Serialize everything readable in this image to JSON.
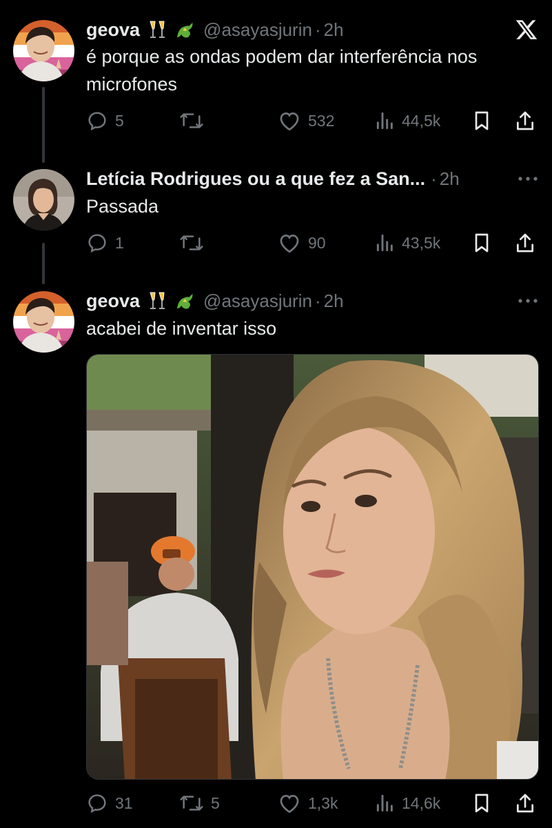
{
  "logo": "x-logo",
  "tweets": [
    {
      "display_name": "geova",
      "emojis": [
        "clinking-glasses-emoji",
        "dragon-emoji"
      ],
      "handle": "@asayasjurin",
      "separator": "·",
      "time": "2h",
      "text": "é porque as ondas podem dar interferência nos microfones",
      "stats": {
        "replies": "5",
        "reposts": "",
        "likes": "532",
        "views": "44,5k"
      }
    },
    {
      "display_name": "Letícia Rodrigues ou a que fez a San...",
      "handle": "",
      "separator": "·",
      "time": "2h",
      "text": "Passada",
      "stats": {
        "replies": "1",
        "reposts": "",
        "likes": "90",
        "views": "43,5k"
      }
    },
    {
      "display_name": "geova",
      "emojis": [
        "clinking-glasses-emoji",
        "dragon-emoji"
      ],
      "handle": "@asayasjurin",
      "separator": "·",
      "time": "2h",
      "text": "acabei de inventar isso",
      "media": "photo",
      "stats": {
        "replies": "31",
        "reposts": "5",
        "likes": "1,3k",
        "views": "14,6k"
      }
    }
  ],
  "colors": {
    "background": "#000000",
    "text": "#e7e9ea",
    "muted": "#71767b",
    "thread_line": "#333639",
    "flag_orange": "#e8743b",
    "flag_pink": "#d6558f"
  }
}
